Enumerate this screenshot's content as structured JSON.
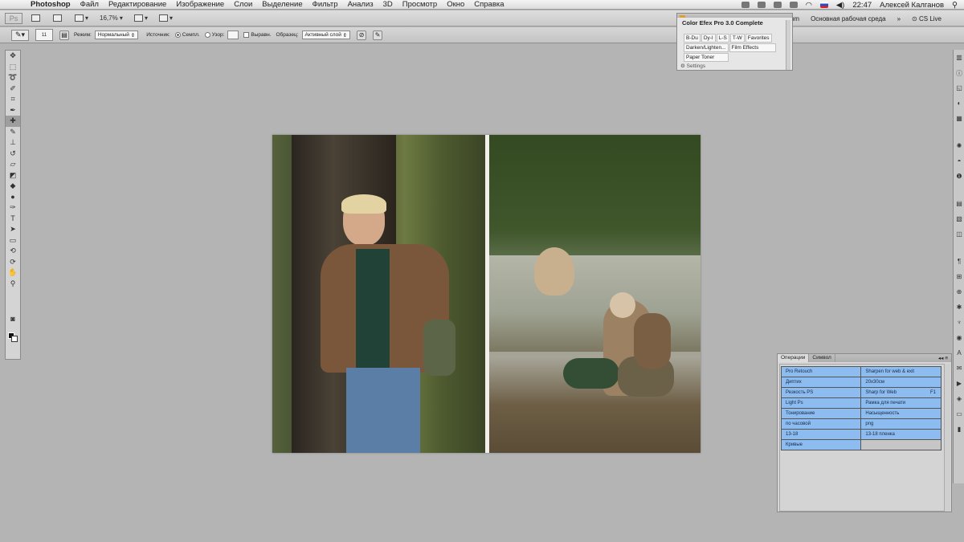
{
  "menubar": {
    "app_name": "Photoshop",
    "menus": [
      "Файл",
      "Редактирование",
      "Изображение",
      "Слои",
      "Выделение",
      "Фильтр",
      "Анализ",
      "3D",
      "Просмотр",
      "Окно",
      "Справка"
    ],
    "clock": "22:47",
    "user": "Алексей Калганов"
  },
  "appbar": {
    "logo": "Ps",
    "zoom": "16,7%",
    "workspace_partial": "riptum",
    "workspace": "Основная рабочая среда",
    "cs_live": "CS Live"
  },
  "options": {
    "brush_size": "11",
    "mode_label": "Режим:",
    "mode_value": "Нормальный",
    "source_label": "Источник:",
    "source_sample": "Семпл.",
    "source_pattern": "Узор:",
    "aligned": "Выравн.",
    "sample_label": "Образец:",
    "sample_value": "Активный слой"
  },
  "color_efex": {
    "title": "Color Efex Pro 3.0 Complete",
    "rows": [
      [
        "B-Du",
        "Dy-I",
        "L-S",
        "T-W",
        "Favorites"
      ],
      [
        "Darken/Lighten...",
        "Film Effects"
      ],
      [
        "Paper Toner"
      ]
    ],
    "footer": "Settings"
  },
  "actions_panel": {
    "tabs": [
      "Операции",
      "Символ"
    ],
    "rows": [
      {
        "left": "Pro Retouch",
        "right": "Sharpen for web & exit",
        "key": ""
      },
      {
        "left": "Диптих",
        "right": "20x30см",
        "key": ""
      },
      {
        "left": "Резкость PS",
        "right": "Sharp for Web",
        "key": "F1"
      },
      {
        "left": "Light Ps",
        "right": "Рамка для печати",
        "key": ""
      },
      {
        "left": "Тонирование",
        "right": "Насыщенность",
        "key": ""
      },
      {
        "left": "по часовой",
        "right": "png",
        "key": ""
      },
      {
        "left": "13-18",
        "right": "13-18 пленка",
        "key": ""
      },
      {
        "left": "Кривые",
        "right": "",
        "key": ""
      }
    ]
  }
}
